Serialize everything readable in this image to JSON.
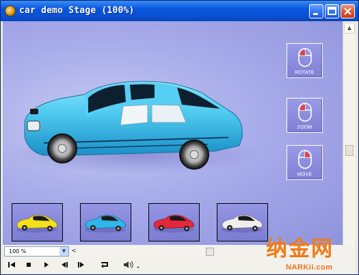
{
  "window": {
    "title": "car demo Stage (100%)"
  },
  "controls": [
    {
      "label": "ROTATE",
      "icon": "mouse-left-icon"
    },
    {
      "label": "ZOOM",
      "icon": "mouse-left-icon"
    },
    {
      "label": "MOVE",
      "icon": "mouse-right-icon"
    }
  ],
  "thumbnails": [
    {
      "color": "yellow",
      "hex": "#f4e11a"
    },
    {
      "color": "blue",
      "hex": "#2fb6ea"
    },
    {
      "color": "red",
      "hex": "#e3283a"
    },
    {
      "color": "white",
      "hex": "#eeeeee"
    }
  ],
  "player": {
    "zoom_value": "100 %",
    "buttons": [
      "step-back-icon",
      "stop-icon",
      "play-icon",
      "rewind-icon",
      "forward-icon",
      "loop-icon",
      "volume-icon"
    ]
  },
  "watermark": {
    "logo": "纳金网",
    "url": "NARKii.com"
  },
  "main_car": {
    "color_hex": "#4cc8ef"
  }
}
